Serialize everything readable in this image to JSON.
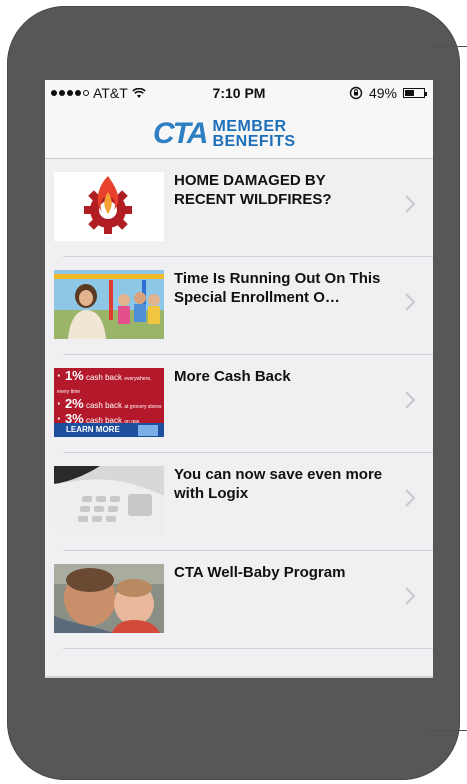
{
  "status_bar": {
    "carrier": "AT&T",
    "time": "7:10 PM",
    "battery": "49%",
    "battery_level": 0.49
  },
  "header": {
    "logo_main": "CTA",
    "logo_line1": "MEMBER",
    "logo_line2": "BENEFITS",
    "brand_color": "#2e7ec2"
  },
  "items": [
    {
      "title": "HOME DAMAGED BY RECENT WILDFIRES?",
      "icon": "flame-gear-icon"
    },
    {
      "title": "Time Is Running Out On This Special Enrollment O…",
      "icon": "photo-kids-playground"
    },
    {
      "title": "More Cash Back",
      "icon": "cash-back-ad",
      "ad": {
        "line1_pct": "1%",
        "line1_text": "cash back",
        "line1_sub": "everywhere, every time",
        "line2_pct": "2%",
        "line2_text": "cash back",
        "line2_sub": "at grocery stores",
        "line3_pct": "3%",
        "line3_text": "cash back",
        "line3_sub": "on gas",
        "cta": "LEARN MORE"
      }
    },
    {
      "title": "You can now save even more with Logix",
      "icon": "photo-telephone"
    },
    {
      "title": "CTA Well-Baby Program",
      "icon": "photo-parent-baby"
    }
  ]
}
